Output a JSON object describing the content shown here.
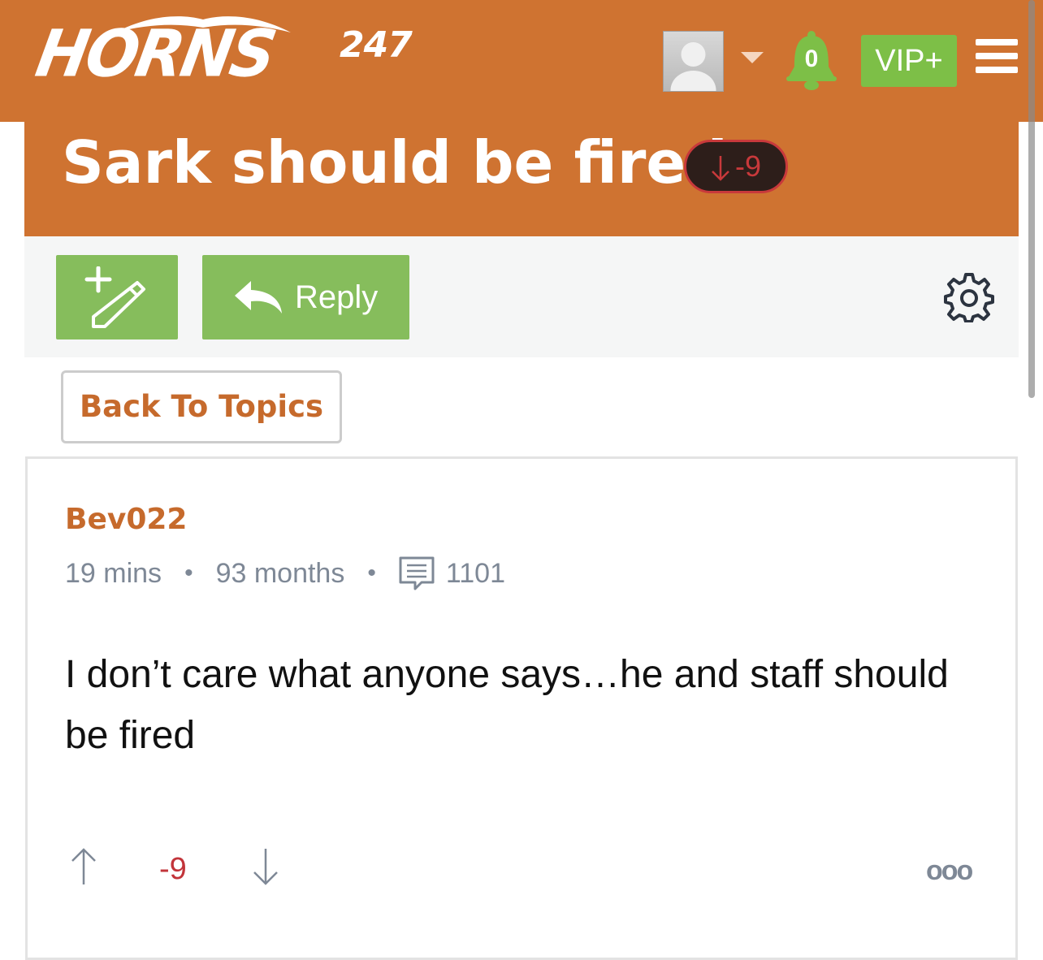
{
  "header": {
    "logo_text": "HORNS",
    "logo_sup": "247",
    "notifications_count": "0",
    "vip_label": "VIP+"
  },
  "thread": {
    "title": "Sark should be fired",
    "vote_score": "-9"
  },
  "toolbar": {
    "reply_label": "Reply"
  },
  "back_label": "Back To Topics",
  "post": {
    "author": "Bev022",
    "time_ago": "19 mins",
    "member_for": "93 months",
    "post_count": "1101",
    "body": "I don’t care what anyone says…he and staff should be fired",
    "score": "-9",
    "more_label": "ooo"
  },
  "colors": {
    "brand_orange": "#cf7331",
    "green": "#86bd5c",
    "downvote_red": "#c8393b"
  }
}
